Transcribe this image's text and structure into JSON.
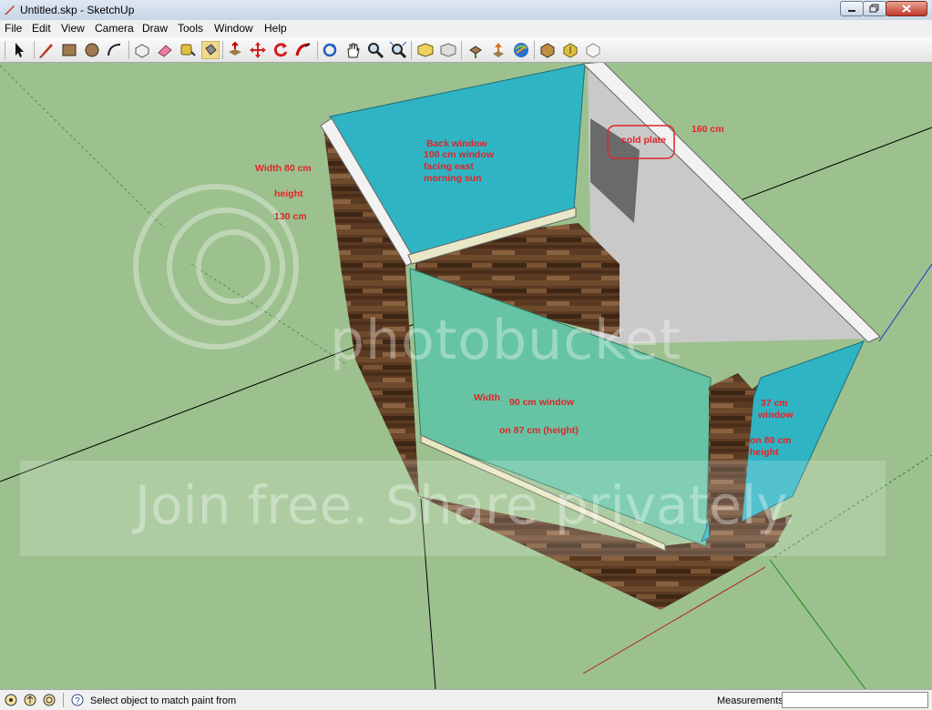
{
  "window": {
    "title": "Untitled.skp - SketchUp",
    "app_icon": "sketchup-pencil-icon"
  },
  "menu": {
    "items": [
      "File",
      "Edit",
      "View",
      "Camera",
      "Draw",
      "Tools",
      "Window",
      "Help"
    ]
  },
  "toolbar": {
    "tools": [
      "select-arrow-icon",
      "pencil-line-icon",
      "rectangle-icon",
      "circle-icon",
      "arc-icon",
      "make-component-icon",
      "eraser-icon",
      "tape-measure-icon",
      "paint-bucket-icon",
      "push-pull-icon",
      "move-icon",
      "rotate-icon",
      "follow-me-icon",
      "orbit-icon",
      "pan-icon",
      "zoom-icon",
      "zoom-extents-icon",
      "previous-view-icon",
      "next-view-icon",
      "get-models-icon",
      "share-model-icon",
      "google-earth-icon",
      "components-icon",
      "materials-icon",
      "styles-icon"
    ]
  },
  "annotations": {
    "back_window": [
      "Back window",
      "100 cm window",
      "facing east",
      "morning sun"
    ],
    "width_left": [
      "Width  80 cm",
      "height",
      "130 cm"
    ],
    "cold_plate": "cold plate",
    "length_top": "160 cm",
    "front_width": "Width",
    "front_window": "90 cm window",
    "front_height": "on 87 cm (height)",
    "right_window": [
      "37 cm",
      "window"
    ],
    "right_height": [
      "on 80 cm",
      "height"
    ]
  },
  "watermark": {
    "logo": "photobucket",
    "tagline": "Join free. Share privately."
  },
  "statusbar": {
    "icons": [
      "status-geo-icon",
      "status-credits-icon",
      "status-user-icon",
      "help-icon"
    ],
    "message": "Select object to match paint from",
    "measurements_label": "Measurements",
    "measurements_value": ""
  },
  "colors": {
    "sky_ground": "#9cc18e",
    "glass": "#2fb4c4",
    "glass_front": "#66c4a4",
    "wall": "#c8c8c8",
    "wood": "#5a3a22",
    "annotation": "#e0242a"
  }
}
